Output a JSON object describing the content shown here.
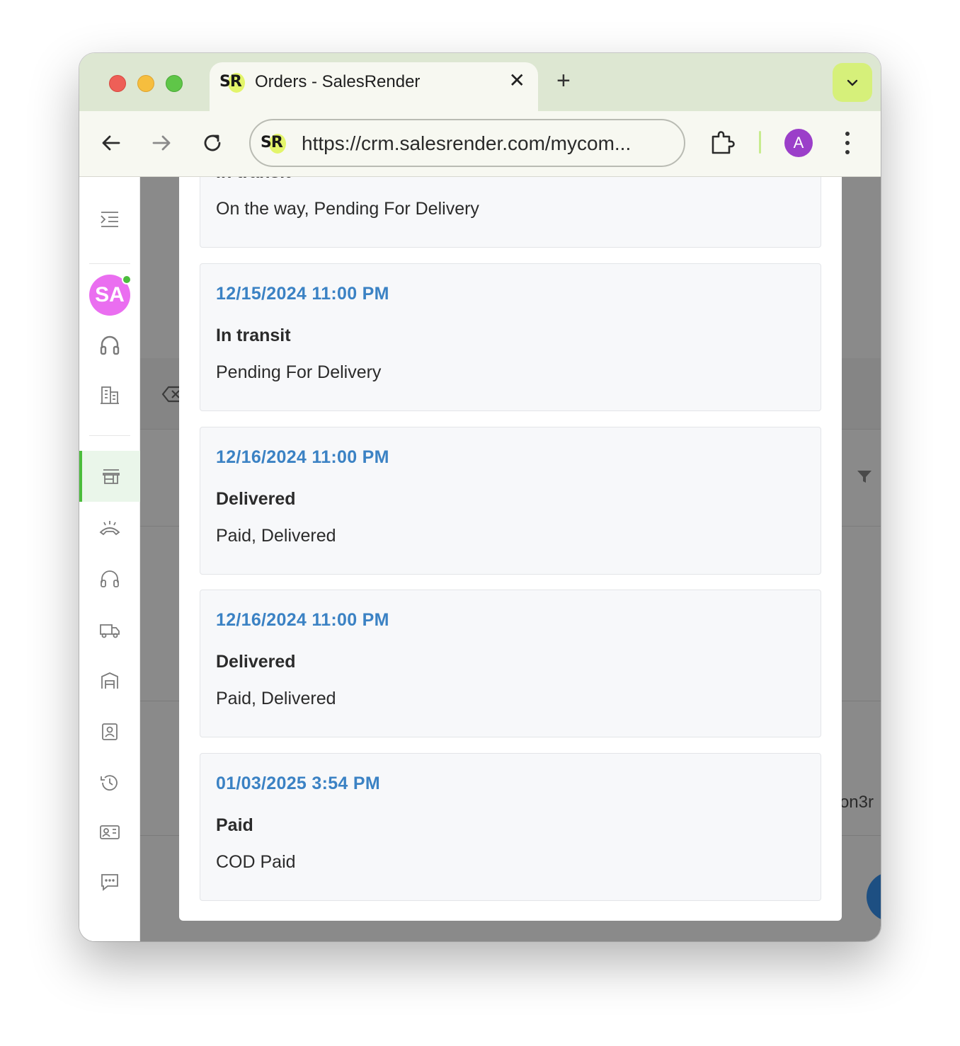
{
  "browser": {
    "tab_title": "Orders - SalesRender",
    "favicon_text": "SR",
    "url": "https://crm.salesrender.com/mycom...",
    "profile_initial": "A",
    "close_glyph": "✕",
    "new_tab_glyph": "+"
  },
  "sidebar": {
    "avatar_initials": "SA",
    "active_item": "orders"
  },
  "background": {
    "partial_text": "on3r"
  },
  "history": {
    "partial_top_card": {
      "status": "In transit",
      "description": "On the way, Pending For Delivery"
    },
    "entries": [
      {
        "date": "12/15/2024 11:00 PM",
        "status": "In transit",
        "description": "Pending For Delivery"
      },
      {
        "date": "12/16/2024 11:00 PM",
        "status": "Delivered",
        "description": "Paid, Delivered"
      },
      {
        "date": "12/16/2024 11:00 PM",
        "status": "Delivered",
        "description": "Paid, Delivered"
      },
      {
        "date": "01/03/2025 3:54 PM",
        "status": "Paid",
        "description": "COD Paid"
      }
    ]
  },
  "colors": {
    "accent_date": "#3b82c4",
    "active_green": "#4bbd3c",
    "avatar_pink": "#ea6ef0",
    "profile_purple": "#9b3fc9"
  }
}
